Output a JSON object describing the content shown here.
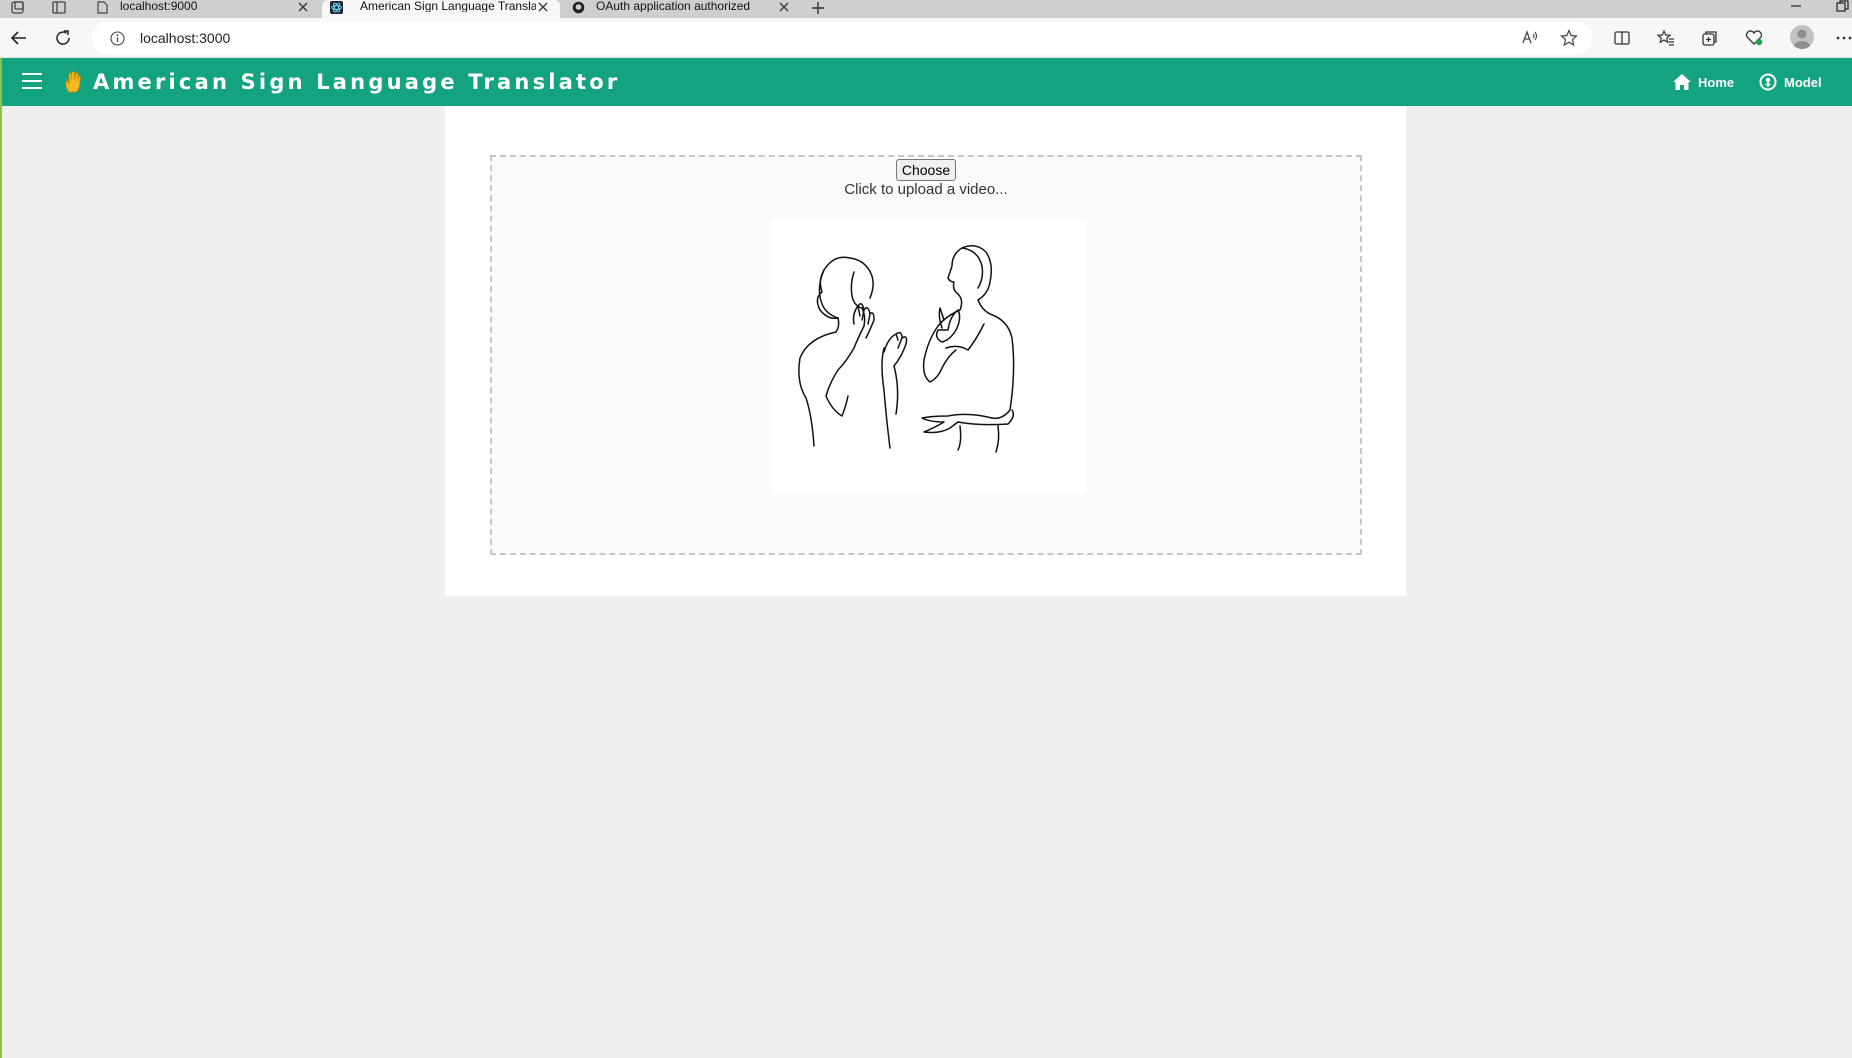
{
  "browser": {
    "tabs": [
      {
        "title": "localhost:9000",
        "active": false
      },
      {
        "title": "American Sign Language Translator",
        "active": true
      },
      {
        "title": "OAuth application authorized",
        "active": false
      }
    ],
    "address": {
      "url": "localhost:3000"
    },
    "icons": [
      "workspaces-icon",
      "tab-actions-icon",
      "new-tab-icon",
      "back-icon",
      "refresh-icon",
      "site-info-icon",
      "read-aloud-icon",
      "add-favorite-icon",
      "split-screen-icon",
      "favorites-icon",
      "collections-icon",
      "browser-essentials-icon",
      "profile-icon",
      "more-icon"
    ]
  },
  "app": {
    "title": "American Sign Language Translator",
    "nav": {
      "home": "Home",
      "model": "Model"
    },
    "accent_color": "#13a37e"
  },
  "upload": {
    "button_label": "Choose",
    "hint": "Click to upload a video..."
  }
}
